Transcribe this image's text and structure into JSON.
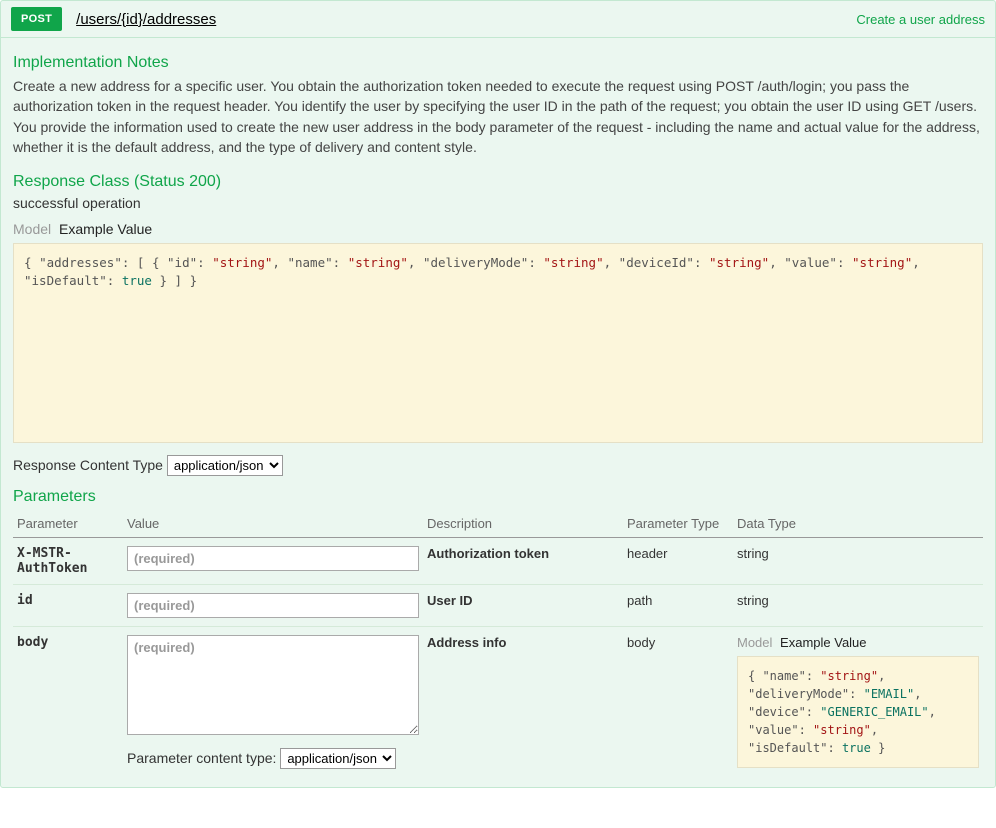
{
  "header": {
    "method": "POST",
    "path": "/users/{id}/addresses",
    "summary": "Create a user address"
  },
  "implementation": {
    "heading": "Implementation Notes",
    "text": "Create a new address for a specific user. You obtain the authorization token needed to execute the request using POST /auth/login; you pass the authorization token in the request header. You identify the user by specifying the user ID in the path of the request; you obtain the user ID using GET /users. You provide the information used to create the new user address in the body parameter of the request - including the name and actual value for the address, whether it is the default address, and the type of delivery and content style."
  },
  "response": {
    "heading": "Response Class (Status 200)",
    "status_desc": "successful operation",
    "tab_model": "Model",
    "tab_example": "Example Value",
    "content_type_label": "Response Content Type",
    "content_type_value": "application/json",
    "example_json": {
      "addresses": [
        {
          "id": "string",
          "name": "string",
          "deliveryMode": "string",
          "deviceId": "string",
          "value": "string",
          "isDefault": true
        }
      ]
    }
  },
  "parameters": {
    "heading": "Parameters",
    "columns": {
      "name": "Parameter",
      "value": "Value",
      "desc": "Description",
      "ptype": "Parameter Type",
      "dtype": "Data Type"
    },
    "rows": [
      {
        "name": "X-MSTR-AuthToken",
        "placeholder": "(required)",
        "desc": "Authorization token",
        "ptype": "header",
        "dtype": "string",
        "kind": "text"
      },
      {
        "name": "id",
        "placeholder": "(required)",
        "desc": "User ID",
        "ptype": "path",
        "dtype": "string",
        "kind": "text"
      },
      {
        "name": "body",
        "placeholder": "(required)",
        "desc": "Address info",
        "ptype": "body",
        "dtype": "model",
        "kind": "textarea"
      }
    ],
    "body_model": {
      "tab_model": "Model",
      "tab_example": "Example Value",
      "example_json": {
        "name": "string",
        "deliveryMode": "EMAIL",
        "device": "GENERIC_EMAIL",
        "value": "string",
        "isDefault": true
      }
    },
    "content_type_label": "Parameter content type:",
    "content_type_value": "application/json"
  }
}
